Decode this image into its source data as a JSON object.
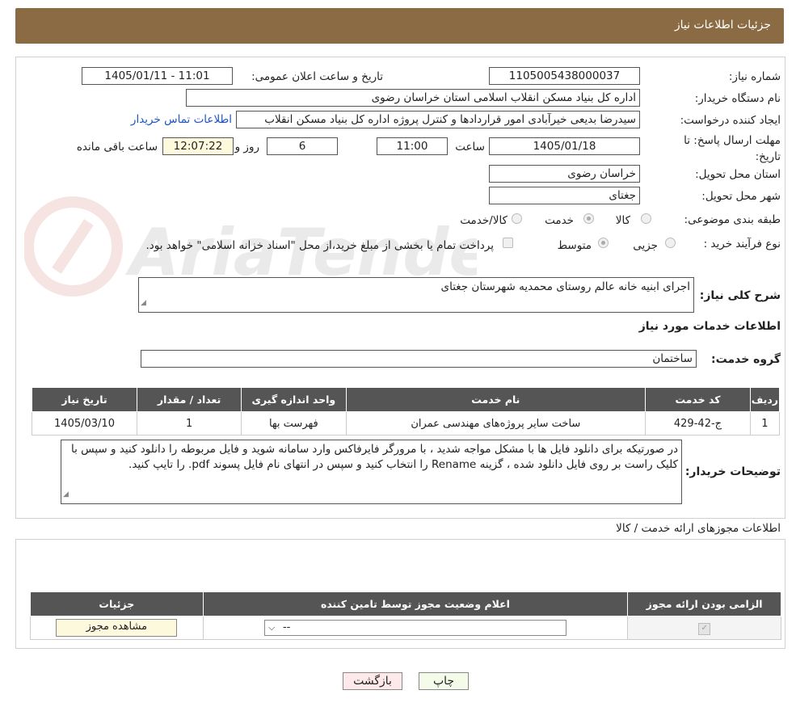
{
  "header": {
    "title": "جزئیات اطلاعات نیاز"
  },
  "watermark": "AriaTender.neT",
  "form": {
    "need_number": {
      "label": "شماره نیاز:",
      "value": "1105005438000037"
    },
    "announce_datetime": {
      "label": "تاریخ و ساعت اعلان عمومی:",
      "value": "1405/01/11 - 11:01"
    },
    "buyer_org": {
      "label": "نام دستگاه خریدار:",
      "value": "اداره کل بنیاد مسکن انقلاب اسلامی استان خراسان رضوی"
    },
    "requester": {
      "label": "ایجاد کننده درخواست:",
      "value": "سیدرضا بدیعی خیرآبادی امور قراردادها و کنترل پروژه اداره کل بنیاد مسکن انقلاب",
      "contact_link": "اطلاعات تماس خریدار"
    },
    "deadline": {
      "label": "مهلت ارسال پاسخ: تا تاریخ:",
      "date": "1405/01/18",
      "time_label": "ساعت",
      "time": "11:00",
      "days": "6",
      "days_label": "روز و",
      "remaining": "12:07:22",
      "remaining_label": "ساعت باقی مانده"
    },
    "delivery_province": {
      "label": "استان محل تحویل:",
      "value": "خراسان رضوی"
    },
    "delivery_city": {
      "label": "شهر محل تحویل:",
      "value": "جغتای"
    },
    "category": {
      "label": "طبقه بندی موضوعی:",
      "options": [
        "کالا",
        "خدمت",
        "کالا/خدمت"
      ],
      "selected": "خدمت"
    },
    "purchase_type": {
      "label": "نوع فرآیند خرید :",
      "options": [
        "جزیی",
        "متوسط"
      ],
      "selected": "متوسط",
      "treasury_note": "پرداخت تمام یا بخشی از مبلغ خرید،از محل \"اسناد خزانه اسلامی\" خواهد بود."
    },
    "general_desc": {
      "label": "شرح کلی نیاز:",
      "value": "اجرای ابنیه خانه عالم روستای محمدیه شهرستان جغتای"
    },
    "services_title": "اطلاعات خدمات مورد نیاز",
    "service_group": {
      "label": "گروه خدمت:",
      "value": "ساختمان"
    },
    "services_table": {
      "headers": [
        "ردیف",
        "کد خدمت",
        "نام خدمت",
        "واحد اندازه گیری",
        "تعداد / مقدار",
        "تاریخ نیاز"
      ],
      "rows": [
        [
          "1",
          "ج-42-429",
          "ساخت سایر پروژه‌های مهندسی عمران",
          "فهرست بها",
          "1",
          "1405/03/10"
        ]
      ]
    },
    "buyer_notes": {
      "label": "توضیحات خریدار:",
      "value": "در صورتیکه برای دانلود فایل ها با مشکل مواجه شدید ، با مرورگر فایرفاکس وارد سامانه شوید و فایل مربوطه را دانلود کنید و سپس با کلیک راست بر روی فایل دانلود شده ، گزینه Rename را انتخاب کنید و سپس در انتهای نام فایل پسوند pdf. را تایپ کنید."
    }
  },
  "permits": {
    "title": "اطلاعات مجوزهای ارائه خدمت / کالا",
    "headers": [
      "الزامی بودن ارائه مجوز",
      "اعلام وضعیت مجوز توسط تامین کننده",
      "جزئیات"
    ],
    "select_value": "--",
    "view_button": "مشاهده مجوز"
  },
  "buttons": {
    "print": "چاپ",
    "back": "بازگشت"
  }
}
